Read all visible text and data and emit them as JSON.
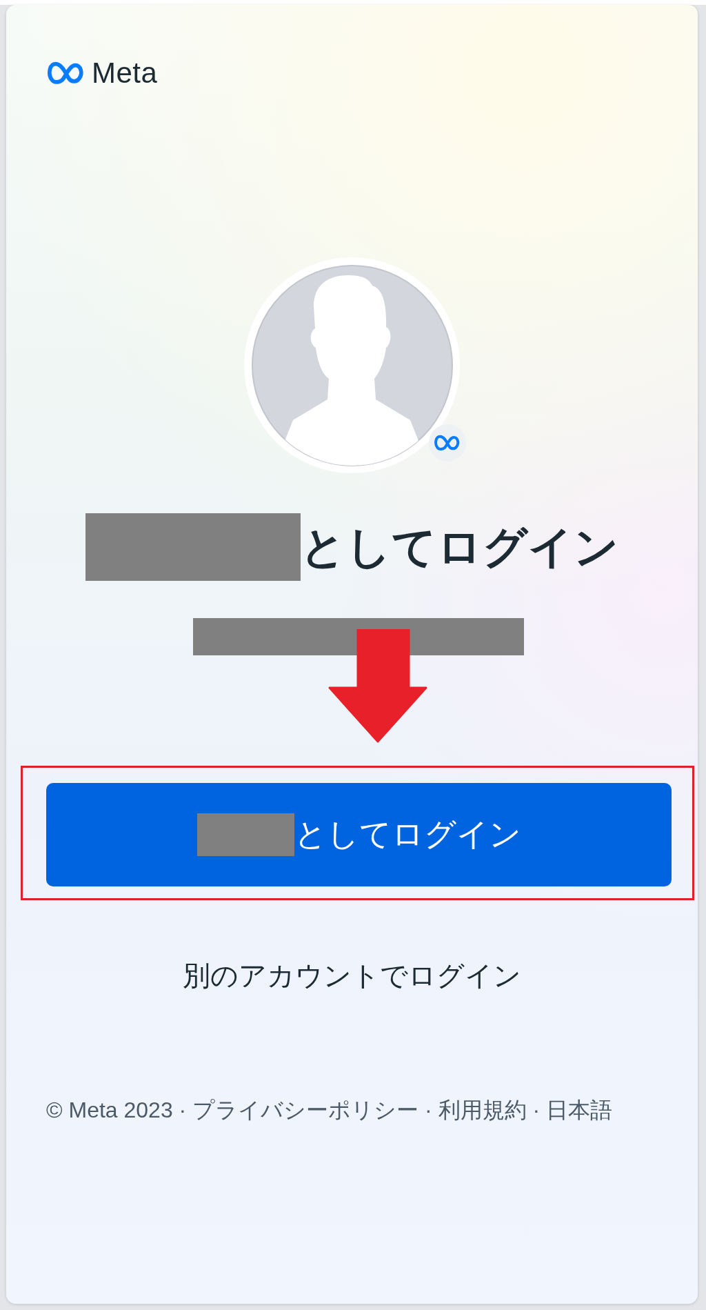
{
  "logo": {
    "text": "Meta"
  },
  "title": {
    "text": "としてログイン"
  },
  "primary_button": {
    "label": "としてログイン"
  },
  "alt_login": {
    "label": "別のアカウントでログイン"
  },
  "footer": {
    "text": "© Meta 2023 · プライバシーポリシー · 利用規約 · 日本語"
  }
}
